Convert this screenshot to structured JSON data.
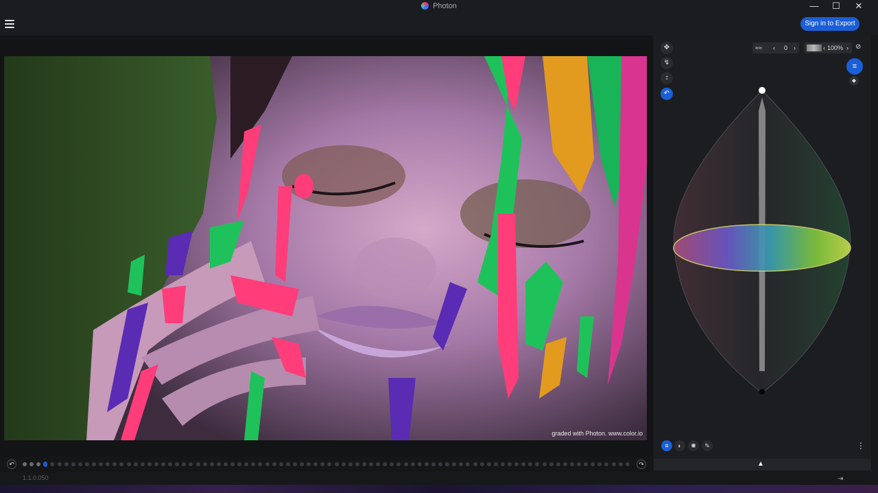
{
  "window": {
    "title": "Photon",
    "controls": {
      "minimize": "—",
      "maximize": "☐",
      "close": "✕"
    }
  },
  "header": {
    "sign_in_label": "Sign in to Export"
  },
  "viewer": {
    "watermark": "graded with Photon. www.color.io"
  },
  "timeline": {
    "undo_glyph": "↶",
    "redo_glyph": "↷",
    "active_index": 4,
    "total_dots": 88
  },
  "status": {
    "version": "1.1.0.050"
  },
  "panel": {
    "tools": [
      {
        "name": "move-tool",
        "glyph": "✥"
      },
      {
        "name": "curve-tool",
        "glyph": "↯"
      },
      {
        "name": "vertical-tool",
        "glyph": "↕"
      },
      {
        "name": "rotate-tool",
        "glyph": "↶"
      }
    ],
    "strength_value": "0",
    "opacity_value": "100%",
    "bottom_tabs": [
      "layers-icon",
      "color-wheel-icon",
      "gear-icon",
      "wrench-icon"
    ],
    "more_glyph": "⋮",
    "collapse_glyph": "▲"
  },
  "colors": {
    "accent": "#1a5fd8",
    "background": "#17181a"
  }
}
